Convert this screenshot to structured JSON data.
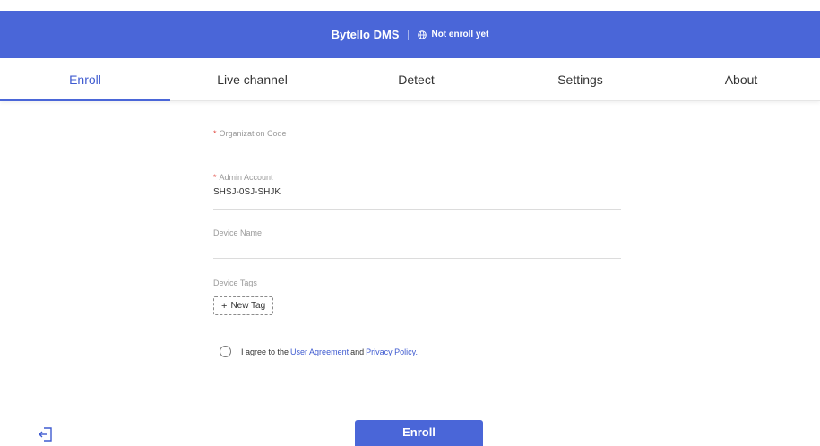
{
  "header": {
    "title": "Bytello DMS",
    "status_icon": "globe-icon",
    "status": "Not enroll yet",
    "color": "#4a66d8"
  },
  "tabs": [
    {
      "label": "Enroll",
      "active": true
    },
    {
      "label": "Live channel",
      "active": false
    },
    {
      "label": "Detect",
      "active": false
    },
    {
      "label": "Settings",
      "active": false
    },
    {
      "label": "About",
      "active": false
    }
  ],
  "form": {
    "organization_code": {
      "label": "Organization Code",
      "required": true,
      "value": ""
    },
    "admin_account": {
      "label": "Admin Account",
      "required": true,
      "value": "SHSJ-0SJ-SHJK"
    },
    "device_name": {
      "label": "Device Name",
      "required": false,
      "value": ""
    },
    "device_tags": {
      "label": "Device Tags",
      "new_tag_label": "New Tag"
    }
  },
  "agreement": {
    "prefix": "I agree to the",
    "user_agreement": "User Agreement",
    "and": "and",
    "privacy_policy": "Privacy Policy.",
    "checked": false
  },
  "footer": {
    "exit_icon": "exit-icon",
    "enroll_label": "Enroll"
  }
}
